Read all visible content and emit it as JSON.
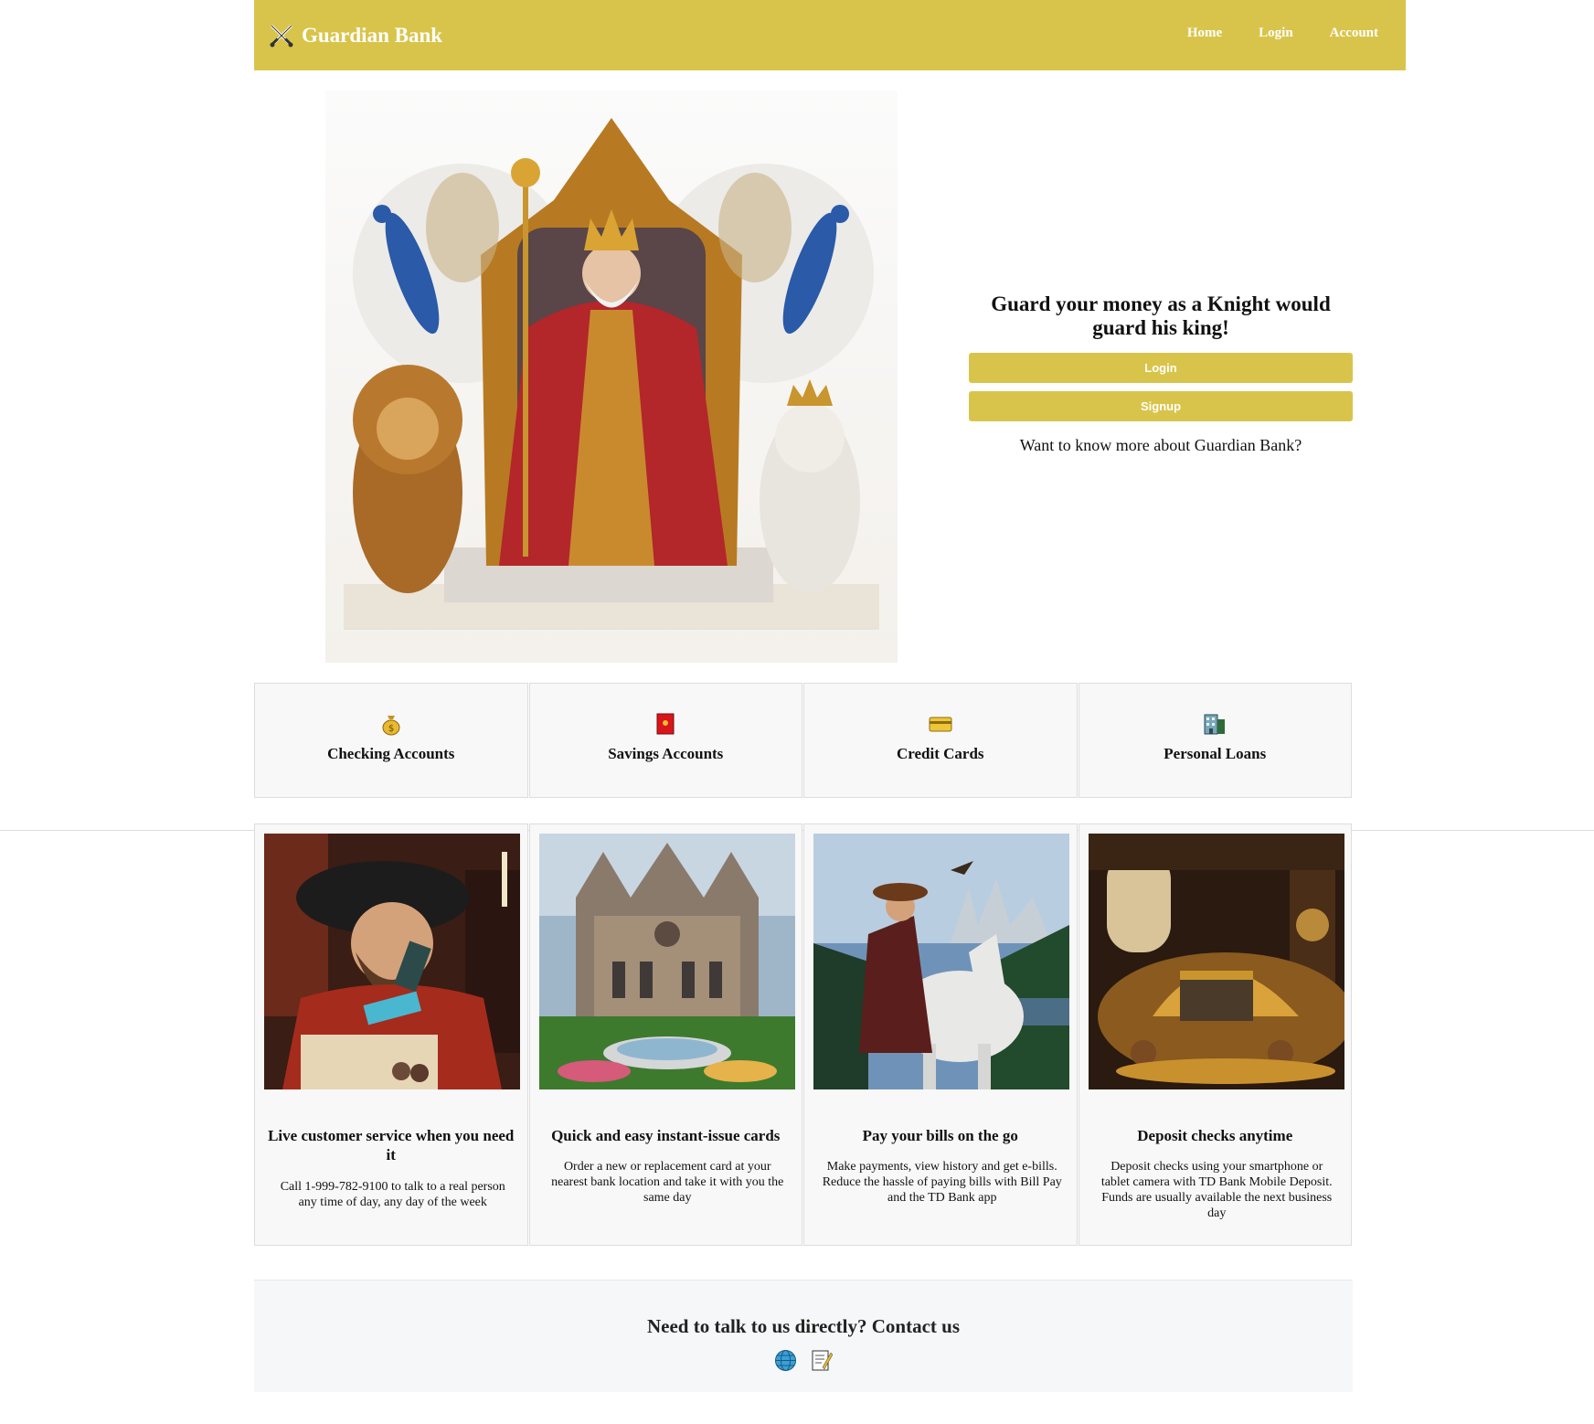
{
  "nav": {
    "brand": "Guardian Bank",
    "links": [
      "Home",
      "Login",
      "Account"
    ]
  },
  "hero": {
    "heading": "Guard your money as a Knight would guard his king!",
    "login_label": "Login",
    "signup_label": "Signup",
    "more_text": "Want to know more about Guardian Bank?"
  },
  "products": [
    {
      "label": "Checking Accounts",
      "icon": "money-bag-icon"
    },
    {
      "label": "Savings Accounts",
      "icon": "red-envelope-icon"
    },
    {
      "label": "Credit Cards",
      "icon": "credit-card-icon"
    },
    {
      "label": "Personal Loans",
      "icon": "office-building-icon"
    }
  ],
  "features": [
    {
      "title": "Live customer service when you need it",
      "text": "Call 1-999-782-9100 to talk to a real person any time of day, any day of the week"
    },
    {
      "title": "Quick and easy instant-issue cards",
      "text": "Order a new or replacement card at your nearest bank location and take it with you the same day"
    },
    {
      "title": "Pay your bills on the go",
      "text": "Make payments, view history and get e-bills. Reduce the hassle of paying bills with Bill Pay and the TD Bank app"
    },
    {
      "title": "Deposit checks anytime",
      "text": "Deposit checks using your smartphone or tablet camera with TD Bank Mobile Deposit. Funds are usually available the next business day"
    }
  ],
  "contact": {
    "title": "Need to talk to us directly? Contact us",
    "icons": [
      "globe-icon",
      "memo-icon"
    ]
  },
  "colors": {
    "brand": "#d9c44b",
    "card_bg": "#f8f8f8",
    "card_border": "#dddddd"
  }
}
